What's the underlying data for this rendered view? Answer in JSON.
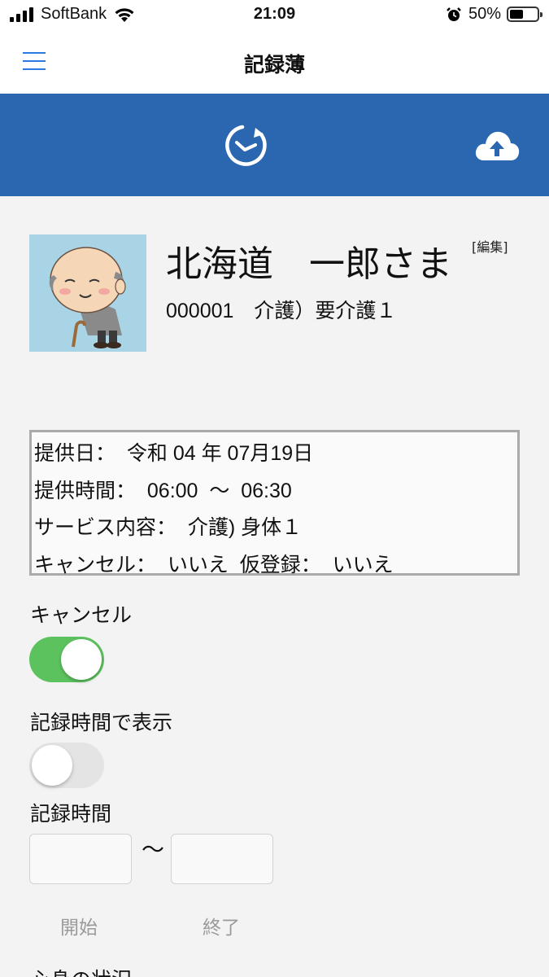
{
  "status_bar": {
    "carrier": "SoftBank",
    "time": "21:09",
    "battery_percent": "50%",
    "battery_level": 0.5
  },
  "nav": {
    "title": "記録薄"
  },
  "toolbar": {
    "history_icon": "history-clock-icon",
    "upload_icon": "cloud-upload-icon"
  },
  "patient": {
    "name": "北海道　一郎さま",
    "edit": "[編集]",
    "info": "000001　介護）要介護１"
  },
  "service_info": {
    "date": "提供日：  令和 04 年 07月19日",
    "time": "提供時間：  06:00  〜  06:30",
    "content": "サービス内容：  介護) 身体１",
    "cancel": "キャンセル：  いいえ  仮登録：  いいえ"
  },
  "form": {
    "cancel_label": "キャンセル",
    "cancel_on": true,
    "record_time_display_label": "記録時間で表示",
    "record_time_display_on": false,
    "record_time_label": "記録時間",
    "start_value": "",
    "end_value": "",
    "tilde": "〜",
    "start_label": "開始",
    "end_label": "終了",
    "next_section_label": "心身の状況"
  },
  "colors": {
    "toolbar_blue": "#2b67b0",
    "toggle_on": "#5cc25e",
    "menu_blue": "#2a7ae2"
  }
}
